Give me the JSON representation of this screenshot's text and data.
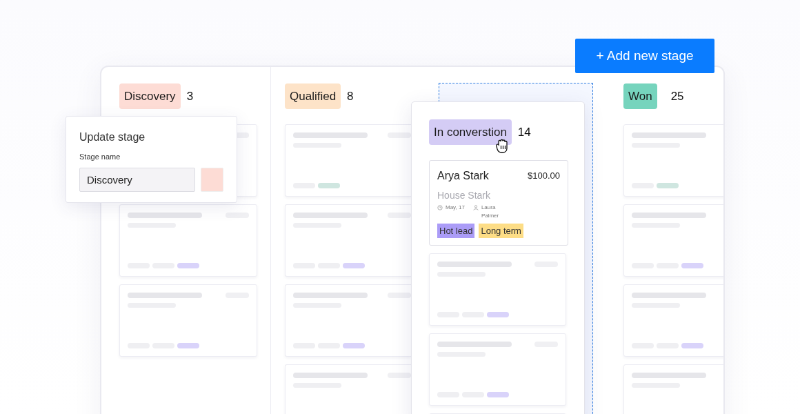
{
  "add_button": {
    "label": "+ Add new stage"
  },
  "columns": [
    {
      "kind": "stage",
      "name": "Discovery",
      "count": "3",
      "color": "#fddcd5",
      "cards": [
        {
          "kind": "covered"
        },
        {
          "kind": "skeleton",
          "color": "#d9d3fa"
        },
        {
          "kind": "skeleton",
          "color": "#d9d3fa"
        }
      ]
    },
    {
      "kind": "stage",
      "name": "Qualified",
      "count": "8",
      "color": "#fde3c8",
      "cards": [
        {
          "kind": "skeleton",
          "color": "#cfe6e0"
        },
        {
          "kind": "skeleton",
          "color": "#d9d3fa"
        },
        {
          "kind": "skeleton",
          "color": "#d9d3fa"
        },
        {
          "kind": "skeleton"
        }
      ]
    },
    {
      "kind": "drop_zone"
    },
    {
      "kind": "stage",
      "name": "Won",
      "count": "25",
      "color": "#76d4bd",
      "cards": [
        {
          "kind": "skeleton",
          "color": "#cfe6e0"
        },
        {
          "kind": "skeleton",
          "color": "#d9d3fa"
        },
        {
          "kind": "skeleton",
          "color": "#d9d3fa"
        },
        {
          "kind": "skeleton"
        }
      ]
    }
  ],
  "update_stage": {
    "title": "Update stage",
    "field_label": "Stage name",
    "value": "Discovery"
  },
  "dragged_column": {
    "name": "In converstion",
    "count": "14",
    "color": "#d4ccf5",
    "deal": {
      "name": "Arya Stark",
      "amount": "$100.00",
      "company": "House Stark",
      "date": "May, 17",
      "owner": "Laura Palmer",
      "tags": [
        {
          "label": "Hot lead",
          "color": "#ab9cf7"
        },
        {
          "label": "Long term",
          "color": "#fddd86"
        }
      ]
    },
    "cards": [
      {
        "kind": "skeleton",
        "color": "#d9d3fa"
      },
      {
        "kind": "skeleton",
        "color": "#d9d3fa"
      },
      {
        "kind": "skeleton"
      }
    ]
  }
}
